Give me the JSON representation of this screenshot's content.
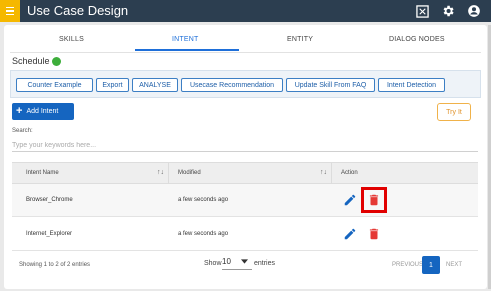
{
  "app": {
    "title": "Use Case Design"
  },
  "tabs": [
    {
      "label": "SKILLS"
    },
    {
      "label": "INTENT"
    },
    {
      "label": "ENTITY"
    },
    {
      "label": "DIALOG NODES"
    }
  ],
  "schedule": {
    "label": "Schedule",
    "status_color": "#3dae3b"
  },
  "toolbar": {
    "buttons": [
      {
        "label": "Counter Example"
      },
      {
        "label": "Export"
      },
      {
        "label": "ANALYSE"
      },
      {
        "label": "Usecase Recommendation"
      },
      {
        "label": "Update Skill From FAQ"
      },
      {
        "label": "Intent Detection"
      }
    ]
  },
  "actions": {
    "add_intent": "Add Intent",
    "try_it": "Try It"
  },
  "search": {
    "label": "Search:",
    "placeholder": "Type your keywords here..."
  },
  "table": {
    "columns": [
      "Intent Name",
      "Modified",
      "Action"
    ],
    "rows": [
      {
        "name": "Browser_Chrome",
        "modified": "a few seconds ago"
      },
      {
        "name": "Internet_Explorer",
        "modified": "a few seconds ago"
      }
    ]
  },
  "pagination": {
    "info": "Showing 1 to 2 of 2 entries",
    "show_label": "Show",
    "page_size": "10",
    "entries_label": "entries",
    "previous": "PREVIOUS",
    "current_page": "1",
    "next": "NEXT"
  },
  "colors": {
    "topbar": "#2c3e50",
    "menu_button": "#f5b800",
    "accent": "#1565c0",
    "delete": "#e53935",
    "highlight": "#e10000"
  },
  "icons": {
    "menu": "hamburger-icon",
    "fullscreen": "fullscreen-icon",
    "settings": "gear-icon",
    "account": "user-icon",
    "sort": "sort-icon",
    "edit": "pencil-icon",
    "delete": "trash-icon",
    "dropdown": "caret-down-icon"
  }
}
